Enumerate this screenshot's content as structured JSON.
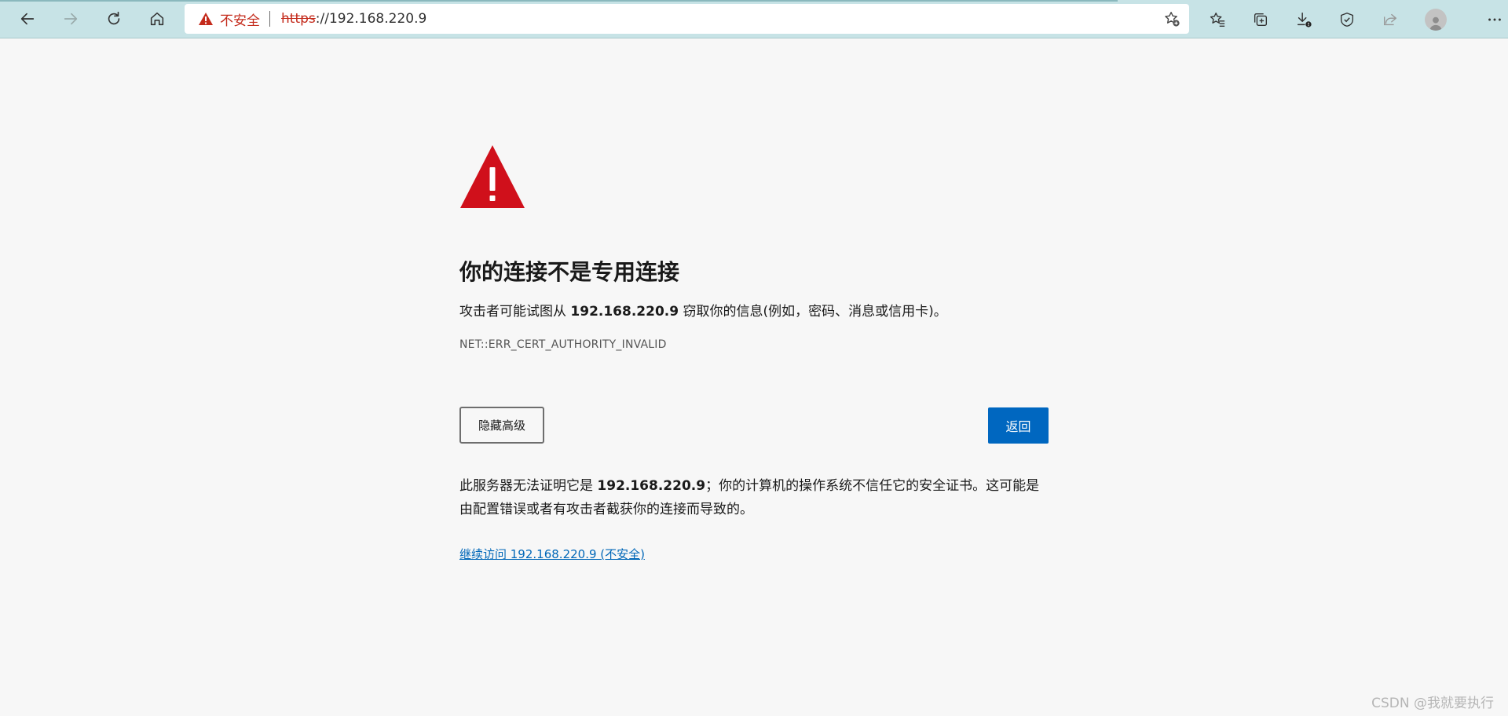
{
  "browser": {
    "address_bar": {
      "security_label": "不安全",
      "url_scheme": "https",
      "url_rest": "://192.168.220.9"
    },
    "nav_icons": [
      "back-icon",
      "forward-icon",
      "refresh-icon",
      "home-icon"
    ],
    "toolbar_icons": [
      "favorites-icon",
      "collections-icon",
      "downloads-icon",
      "browser-essentials-icon",
      "share-icon",
      "profile-avatar-icon",
      "more-options-icon"
    ]
  },
  "page": {
    "heading": "你的连接不是专用连接",
    "desc_prefix": "攻击者可能试图从 ",
    "desc_host": "192.168.220.9",
    "desc_suffix": " 窃取你的信息(例如，密码、消息或信用卡)。",
    "error_code": "NET::ERR_CERT_AUTHORITY_INVALID",
    "hide_advanced_label": "隐藏高级",
    "back_label": "返回",
    "detail_prefix": "此服务器无法证明它是 ",
    "detail_host": "192.168.220.9",
    "detail_suffix": "；你的计算机的操作系统不信任它的安全证书。这可能是由配置错误或者有攻击者截获你的连接而导致的。",
    "proceed_link": "继续访问 192.168.220.9 (不安全)"
  },
  "watermark": "CSDN @我就要执行",
  "colors": {
    "toolbar_bg": "#c7e3e6",
    "page_bg": "#f7f7f7",
    "warning_red": "#d0101b",
    "primary_button": "#0067c0",
    "link": "#0067b8"
  }
}
